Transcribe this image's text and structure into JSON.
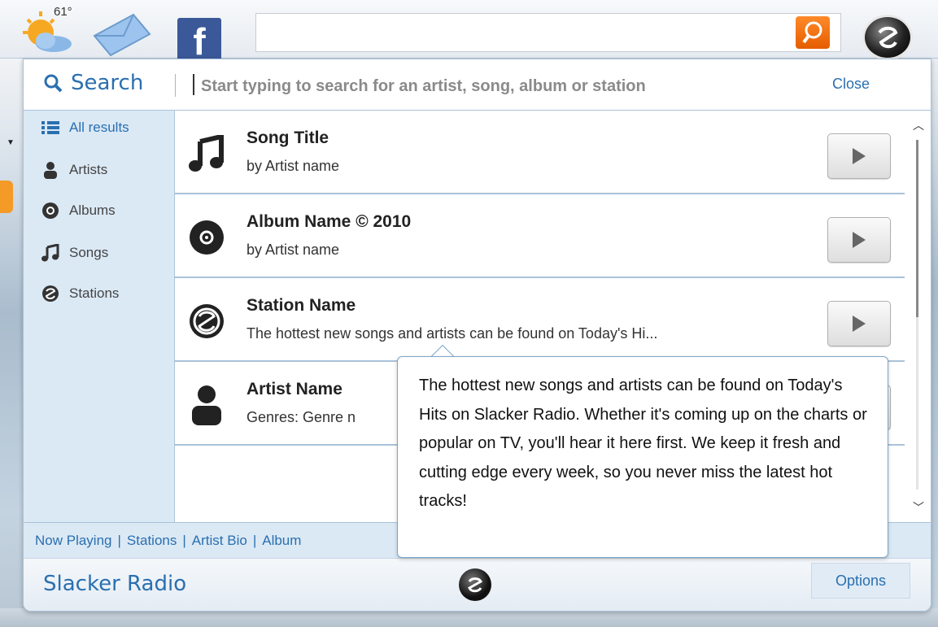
{
  "toolbar": {
    "weather_temp": "61°",
    "icons": [
      "weather-icon",
      "mail-icon",
      "facebook-icon",
      "search-go-icon",
      "slacker-logo-icon"
    ],
    "facebook_glyph": "f",
    "accent_orange": "#f07d11"
  },
  "search": {
    "label": "Search",
    "placeholder": "Start typing to search for an artist, song, album or station",
    "close_label": "Close"
  },
  "sidebar": {
    "items": [
      {
        "label": "All results",
        "icon": "list-icon",
        "active": true
      },
      {
        "label": "Artists",
        "icon": "person-icon",
        "active": false
      },
      {
        "label": "Albums",
        "icon": "disc-icon",
        "active": false
      },
      {
        "label": "Songs",
        "icon": "music-note-icon",
        "active": false
      },
      {
        "label": "Stations",
        "icon": "station-icon",
        "active": false
      }
    ]
  },
  "results": [
    {
      "title": "Song Title",
      "subtitle": "by Artist name",
      "icon": "music-note-icon"
    },
    {
      "title": "Album Name © 2010",
      "subtitle": "by Artist name",
      "icon": "disc-icon"
    },
    {
      "title": "Station Name",
      "subtitle": "The hottest new songs and artists can be found on Today's Hi...",
      "icon": "station-icon"
    },
    {
      "title": "Artist Name",
      "subtitle": "Genres: Genre n",
      "icon": "person-icon"
    }
  ],
  "tooltip": {
    "text": "The hottest new songs and artists can be found on Today's Hits on Slacker Radio.  Whether it's coming up on the charts or popular on TV, you'll hear it here first. We keep it fresh and cutting edge every week, so you never miss the latest hot tracks!"
  },
  "nav": {
    "links": [
      "Now Playing",
      "Stations",
      "Artist Bio",
      "Album"
    ],
    "separator": "|"
  },
  "footer": {
    "app_name": "Slacker Radio",
    "options_label": "Options"
  },
  "colors": {
    "accent_blue": "#2a6fb0",
    "panel_border": "#a9c2d8",
    "sidebar_bg": "#dbe9f5"
  }
}
